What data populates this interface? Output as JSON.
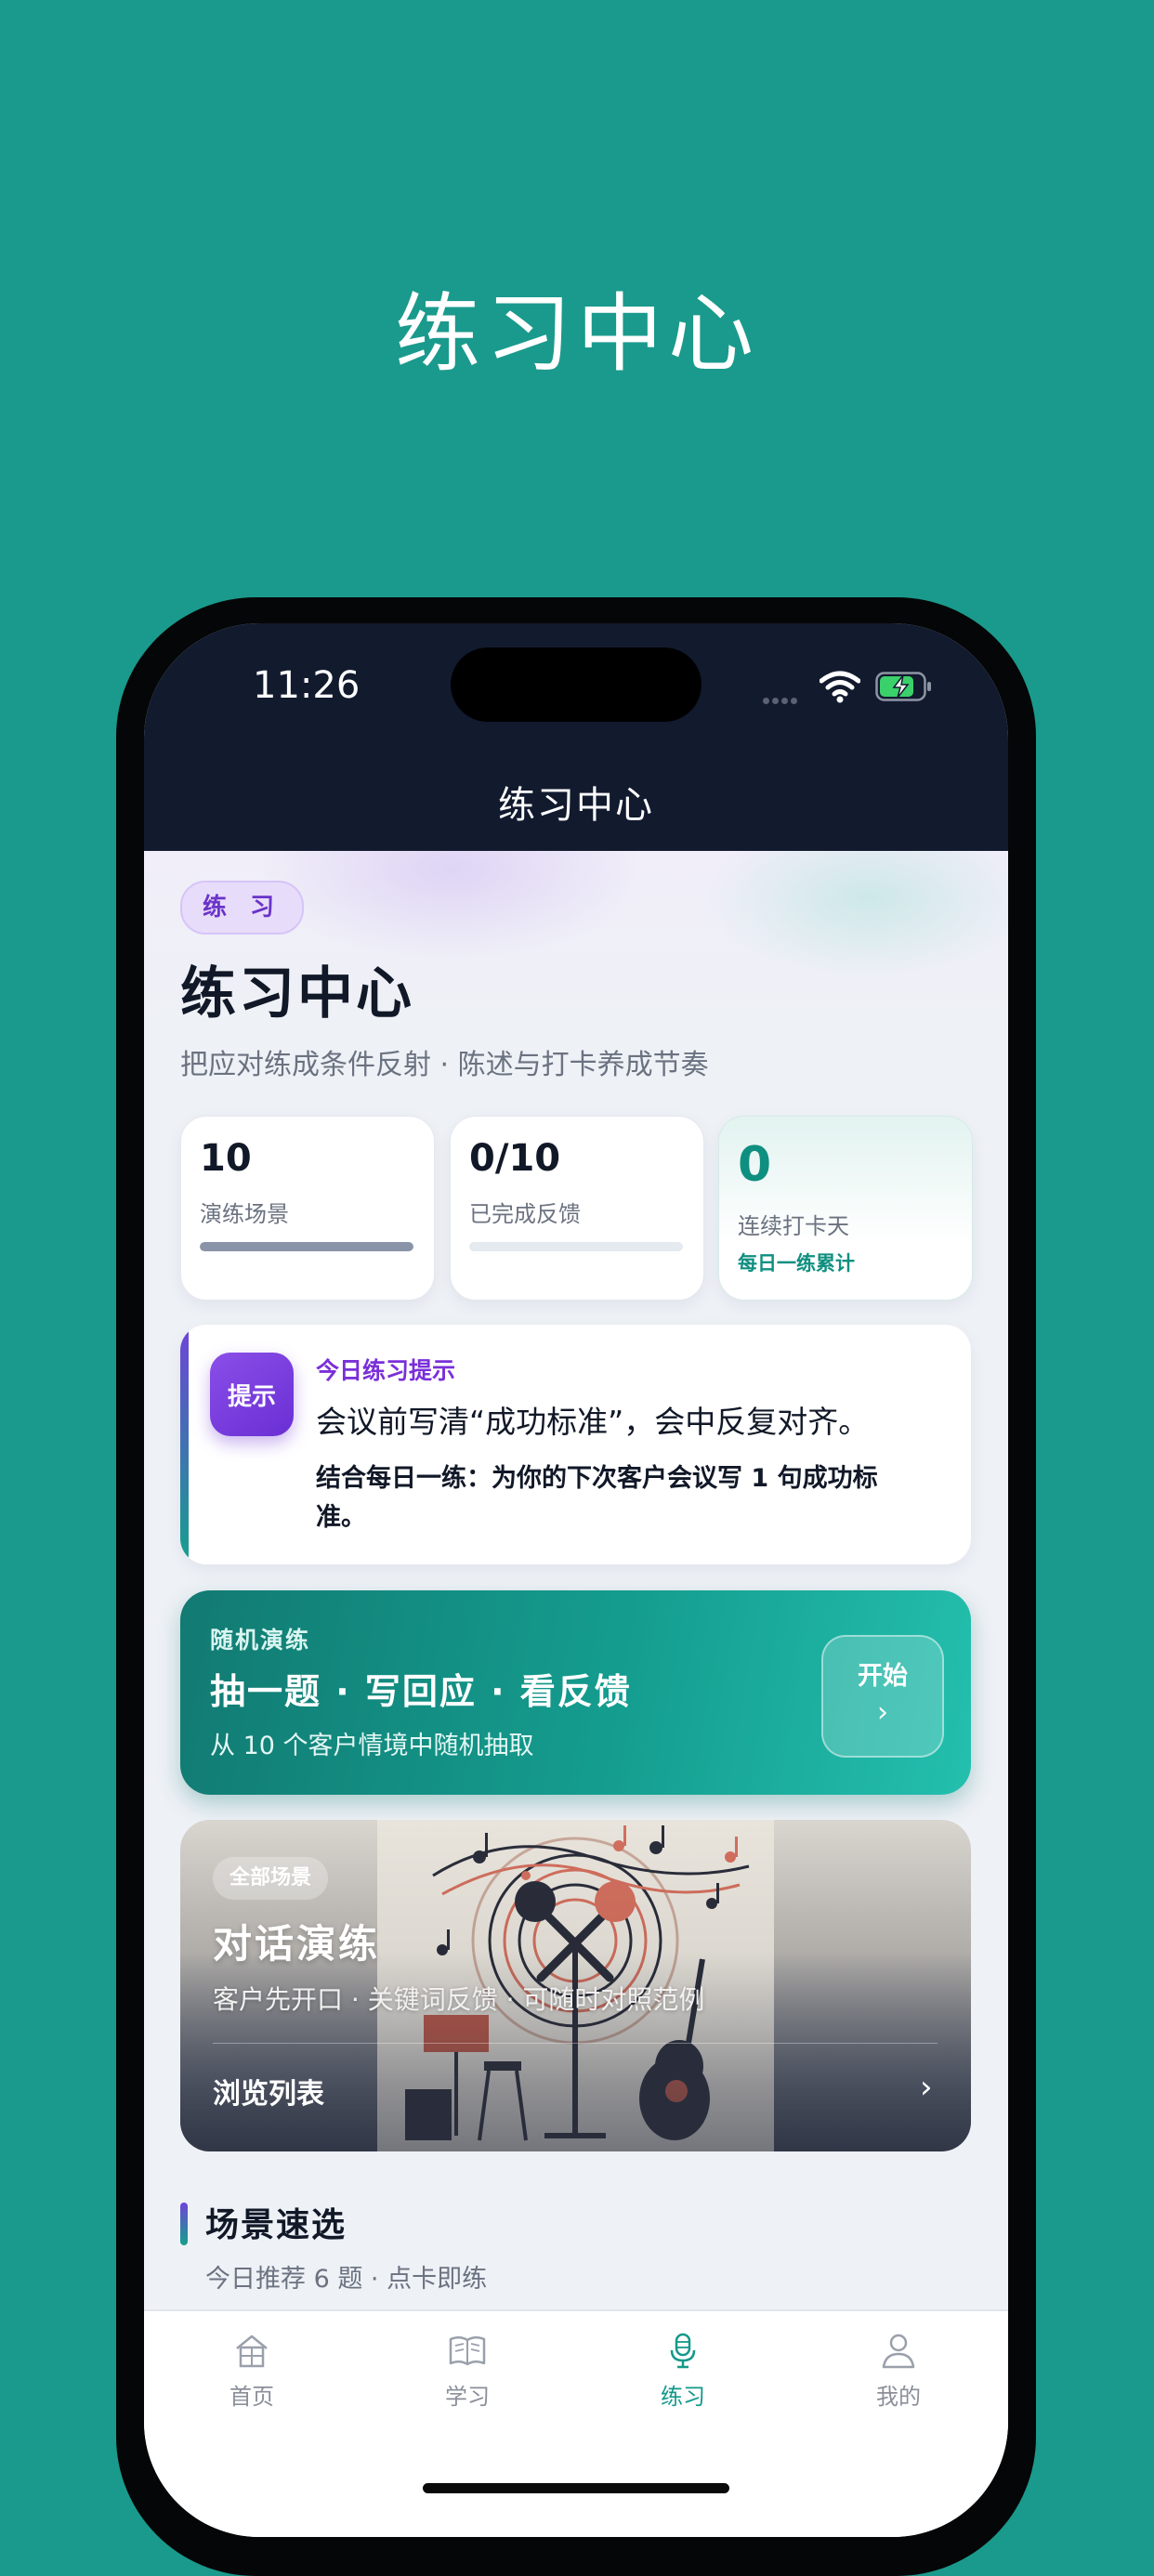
{
  "headline": "练习中心",
  "status_bar": {
    "time": "11:26"
  },
  "nav": {
    "title": "练习中心"
  },
  "hero": {
    "tag": "练 习",
    "title": "练习中心",
    "subtitle": "把应对练成条件反射 · 陈述与打卡养成节奏"
  },
  "stats": [
    {
      "value": "10",
      "label": "演练场景",
      "progress": 1.0
    },
    {
      "value": "0/10",
      "label": "已完成反馈",
      "progress": 0.0
    },
    {
      "value": "0",
      "label": "连续打卡天",
      "note": "每日一练累计"
    }
  ],
  "tip": {
    "badge": "提示",
    "heading": "今日练习提示",
    "body": "会议前写清“成功标准”，会中反复对齐。",
    "detail": "结合每日一练：为你的下次客户会议写 1 句成功标准。"
  },
  "random": {
    "eyebrow": "随机演练",
    "title": "抽一题 · 写回应 · 看反馈",
    "subtitle": "从 10 个客户情境中随机抽取",
    "start_label": "开始",
    "start_arrow": "›"
  },
  "scene_card": {
    "pill": "全部场景",
    "title": "对话演练",
    "subtitle": "客户先开口 · 关键词反馈 · 可随时对照范例",
    "browse_label": "浏览列表",
    "chevron": "›"
  },
  "section": {
    "title": "场景速选",
    "subtitle": "今日推荐 6 题 · 点卡即练"
  },
  "tabs": [
    {
      "label": "首页",
      "icon": "home-icon",
      "active": false
    },
    {
      "label": "学习",
      "icon": "book-icon",
      "active": false
    },
    {
      "label": "练习",
      "icon": "microphone-icon",
      "active": true
    },
    {
      "label": "我的",
      "icon": "person-icon",
      "active": false
    }
  ],
  "colors": {
    "background": "#1a9a8c",
    "nav_bar": "#121a2e",
    "accent_teal": "#13998a",
    "accent_purple": "#7a2fd8"
  }
}
